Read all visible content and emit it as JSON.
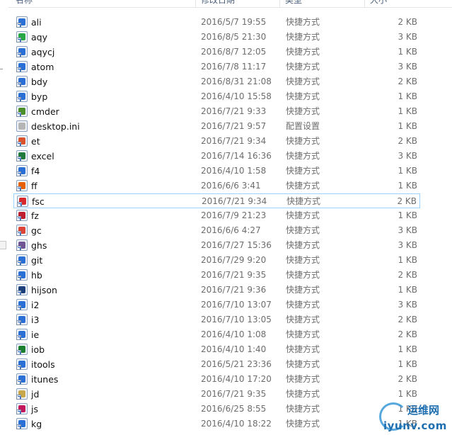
{
  "header": {
    "name": "名称",
    "date": "修改日期",
    "type": "类型",
    "size": "大小"
  },
  "files": [
    {
      "name": "ali",
      "date": "2016/5/7 19:55",
      "type": "快捷方式",
      "size": "2 KB",
      "icon": "shortcut-blue-icon",
      "color": "#2a6fd6"
    },
    {
      "name": "aqy",
      "date": "2016/8/5 21:30",
      "type": "快捷方式",
      "size": "3 KB",
      "icon": "iqiyi-green-icon",
      "color": "#28a745"
    },
    {
      "name": "aqycj",
      "date": "2016/8/7 12:05",
      "type": "快捷方式",
      "size": "1 KB",
      "icon": "shortcut-blue-icon",
      "color": "#2a6fd6"
    },
    {
      "name": "atom",
      "date": "2016/7/8 11:17",
      "type": "快捷方式",
      "size": "3 KB",
      "icon": "shortcut-blue-icon",
      "color": "#2a6fd6"
    },
    {
      "name": "bdy",
      "date": "2016/8/31 21:08",
      "type": "快捷方式",
      "size": "2 KB",
      "icon": "shortcut-blue-icon",
      "color": "#2a6fd6"
    },
    {
      "name": "byp",
      "date": "2016/4/10 15:58",
      "type": "快捷方式",
      "size": "1 KB",
      "icon": "shortcut-blue-icon",
      "color": "#2a6fd6"
    },
    {
      "name": "cmder",
      "date": "2016/7/21 9:33",
      "type": "快捷方式",
      "size": "1 KB",
      "icon": "cmder-green-icon",
      "color": "#4a8f2a"
    },
    {
      "name": "desktop.ini",
      "date": "2016/7/21 9:57",
      "type": "配置设置",
      "size": "1 KB",
      "icon": "settings-file-icon",
      "color": "#b5b5b5"
    },
    {
      "name": "et",
      "date": "2016/7/21 9:34",
      "type": "快捷方式",
      "size": "2 KB",
      "icon": "wps-et-icon",
      "color": "#d9532c"
    },
    {
      "name": "excel",
      "date": "2016/7/14 16:36",
      "type": "快捷方式",
      "size": "3 KB",
      "icon": "excel-icon",
      "color": "#1f7a3c"
    },
    {
      "name": "f4",
      "date": "2016/4/10 1:58",
      "type": "快捷方式",
      "size": "1 KB",
      "icon": "shortcut-blue-icon",
      "color": "#2a6fd6"
    },
    {
      "name": "ff",
      "date": "2016/6/6 3:41",
      "type": "快捷方式",
      "size": "1 KB",
      "icon": "firefox-icon",
      "color": "#e66000"
    },
    {
      "name": "fsc",
      "date": "2016/7/21 9:34",
      "type": "快捷方式",
      "size": "2 KB",
      "icon": "faststone-icon",
      "color": "#d8282b"
    },
    {
      "name": "fz",
      "date": "2016/7/9 21:23",
      "type": "快捷方式",
      "size": "1 KB",
      "icon": "filezilla-icon",
      "color": "#bf1e2e"
    },
    {
      "name": "gc",
      "date": "2016/6/6 4:27",
      "type": "快捷方式",
      "size": "3 KB",
      "icon": "chrome-icon",
      "color": "#db4437"
    },
    {
      "name": "ghs",
      "date": "2016/7/27 15:36",
      "type": "快捷方式",
      "size": "3 KB",
      "icon": "github-icon",
      "color": "#6e5494"
    },
    {
      "name": "git",
      "date": "2016/7/29 9:20",
      "type": "快捷方式",
      "size": "1 KB",
      "icon": "shortcut-blue-icon",
      "color": "#2a6fd6"
    },
    {
      "name": "hb",
      "date": "2016/7/21 9:35",
      "type": "快捷方式",
      "size": "2 KB",
      "icon": "shortcut-blue-icon",
      "color": "#2a6fd6"
    },
    {
      "name": "hijson",
      "date": "2016/7/21 9:36",
      "type": "快捷方式",
      "size": "1 KB",
      "icon": "hijson-icon",
      "color": "#1b3f7a"
    },
    {
      "name": "i2",
      "date": "2016/7/10 13:07",
      "type": "快捷方式",
      "size": "3 KB",
      "icon": "shortcut-blue-icon",
      "color": "#2a6fd6"
    },
    {
      "name": "i3",
      "date": "2016/7/10 13:05",
      "type": "快捷方式",
      "size": "2 KB",
      "icon": "shortcut-blue-icon",
      "color": "#2a6fd6"
    },
    {
      "name": "ie",
      "date": "2016/4/10 1:08",
      "type": "快捷方式",
      "size": "2 KB",
      "icon": "shortcut-blue-icon",
      "color": "#2a6fd6"
    },
    {
      "name": "iob",
      "date": "2016/4/10 1:40",
      "type": "快捷方式",
      "size": "1 KB",
      "icon": "iobit-icon",
      "color": "#1a7f2e"
    },
    {
      "name": "itools",
      "date": "2016/5/21 23:36",
      "type": "快捷方式",
      "size": "1 KB",
      "icon": "shortcut-blue-icon",
      "color": "#2a6fd6"
    },
    {
      "name": "itunes",
      "date": "2016/4/10 17:20",
      "type": "快捷方式",
      "size": "2 KB",
      "icon": "shortcut-blue-icon",
      "color": "#2a6fd6"
    },
    {
      "name": "jd",
      "date": "2016/7/21 9:35",
      "type": "快捷方式",
      "size": "1 KB",
      "icon": "jd-icon",
      "color": "#c8a64b"
    },
    {
      "name": "js",
      "date": "2016/6/25 8:55",
      "type": "快捷方式",
      "size": "1 KB",
      "icon": "js-icon",
      "color": "#c2185b"
    },
    {
      "name": "kg",
      "date": "2016/4/10 18:22",
      "type": "快捷方式",
      "size": "1 KB",
      "icon": "shortcut-blue-icon",
      "color": "#2a6fd6"
    }
  ],
  "selected_index": 12,
  "watermark": {
    "line1": "运维网",
    "line2": "iyunv.com"
  }
}
